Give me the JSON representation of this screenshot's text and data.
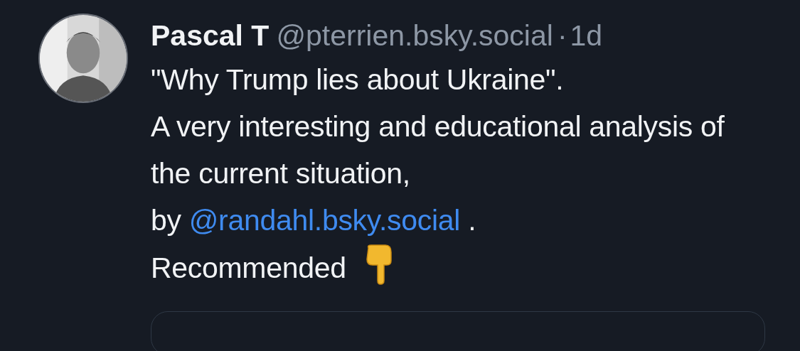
{
  "post": {
    "author": {
      "name": "Pascal T",
      "handle": "@pterrien.bsky.social",
      "separator": "·",
      "time": "1d"
    },
    "body": [
      {
        "kind": "text",
        "text": "\"Why Trump lies about Ukraine\".\nA very interesting and educational analysis of the current situation,\nby "
      },
      {
        "kind": "mention",
        "text": "@randahl.bsky.social"
      },
      {
        "kind": "text",
        "text": " .\nRecommended "
      },
      {
        "kind": "emoji"
      }
    ],
    "embed": {
      "kind": "card"
    }
  }
}
